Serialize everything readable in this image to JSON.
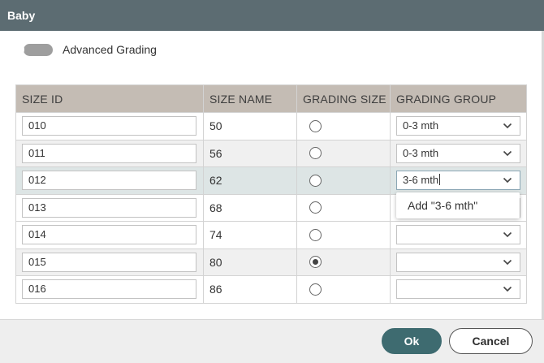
{
  "dialog": {
    "title": "Baby",
    "advanced_grading_label": "Advanced Grading",
    "advanced_grading_on": false
  },
  "table": {
    "headers": [
      "SIZE ID",
      "SIZE NAME",
      "GRADING SIZE",
      "GRADING GROUP"
    ],
    "rows": [
      {
        "size_id": "010",
        "size_name": "50",
        "grading_size": false,
        "grading_group": "0-3 mth"
      },
      {
        "size_id": "011",
        "size_name": "56",
        "grading_size": false,
        "grading_group": "0-3 mth"
      },
      {
        "size_id": "012",
        "size_name": "62",
        "grading_size": false,
        "grading_group": "3-6 mth"
      },
      {
        "size_id": "013",
        "size_name": "68",
        "grading_size": false,
        "grading_group": ""
      },
      {
        "size_id": "014",
        "size_name": "74",
        "grading_size": false,
        "grading_group": ""
      },
      {
        "size_id": "015",
        "size_name": "80",
        "grading_size": true,
        "grading_group": ""
      },
      {
        "size_id": "016",
        "size_name": "86",
        "grading_size": false,
        "grading_group": ""
      }
    ]
  },
  "dropdown": {
    "option_label": "Add \"3-6 mth\""
  },
  "buttons": {
    "ok": "Ok",
    "cancel": "Cancel"
  },
  "colors": {
    "titlebar": "#5c6c72",
    "header_row": "#c4bcb4",
    "ok_button": "#3e6b70",
    "selected_row": "#dde5e5"
  },
  "icons": {
    "caret": "chevron-down-icon",
    "radio_checked": "radio-checked-icon",
    "radio_unchecked": "radio-unchecked-icon"
  }
}
